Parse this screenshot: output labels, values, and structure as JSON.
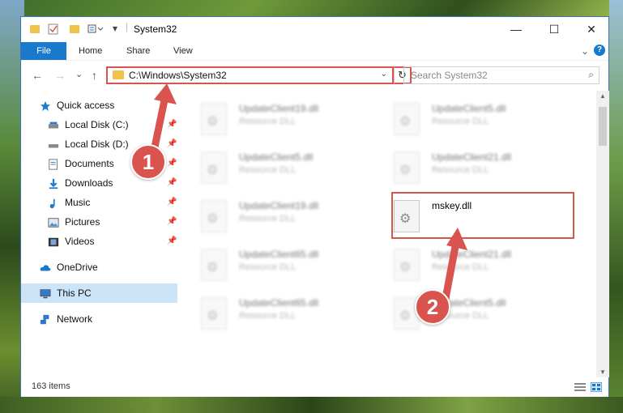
{
  "window": {
    "title": "System32",
    "min_glyph": "—",
    "max_glyph": "☐",
    "close_glyph": "✕"
  },
  "ribbon": {
    "tabs": [
      "File",
      "Home",
      "Share",
      "View"
    ],
    "help_glyph": "?",
    "expand_glyph": "⌄"
  },
  "navigation": {
    "back_glyph": "←",
    "forward_glyph": "→",
    "recent_glyph": "⌄",
    "up_glyph": "↑",
    "address_path": "C:\\Windows\\System32",
    "address_dropdown_glyph": "⌄",
    "refresh_glyph": "↻",
    "search_placeholder": "Search System32",
    "search_glyph": "⌕"
  },
  "nav_pane": {
    "items": [
      {
        "label": "Quick access",
        "icon": "star-icon",
        "pinned": false
      },
      {
        "label": "Local Disk (C:)",
        "icon": "drive-icon",
        "pinned": true
      },
      {
        "label": "Local Disk (D:)",
        "icon": "drive-icon",
        "pinned": true
      },
      {
        "label": "Documents",
        "icon": "documents-icon",
        "pinned": true
      },
      {
        "label": "Downloads",
        "icon": "download-icon",
        "pinned": true
      },
      {
        "label": "Music",
        "icon": "music-icon",
        "pinned": true
      },
      {
        "label": "Pictures",
        "icon": "pictures-icon",
        "pinned": true
      },
      {
        "label": "Videos",
        "icon": "videos-icon",
        "pinned": true
      },
      {
        "label": "OneDrive",
        "icon": "cloud-icon",
        "pinned": false
      },
      {
        "label": "This PC",
        "icon": "computer-icon",
        "pinned": false,
        "selected": true
      },
      {
        "label": "Network",
        "icon": "network-icon",
        "pinned": false
      }
    ],
    "pin_glyph": "📌"
  },
  "files": [
    {
      "name": "UpdateClient19.dll",
      "type": "Resource DLL",
      "blurred": true
    },
    {
      "name": "UpdateClient5.dll",
      "type": "Resource DLL",
      "blurred": true
    },
    {
      "name": "UpdateClient5.dll",
      "type": "Resource DLL",
      "blurred": true
    },
    {
      "name": "UpdateClient21.dll",
      "type": "Resource DLL",
      "blurred": true
    },
    {
      "name": "UpdateClient19.dll",
      "type": "Resource DLL",
      "blurred": true
    },
    {
      "name": "mskey.dll",
      "type": "",
      "blurred": false
    },
    {
      "name": "UpdateClient65.dll",
      "type": "Resource DLL",
      "blurred": true
    },
    {
      "name": "UpdateClient21.dll",
      "type": "Resource DLL",
      "blurred": true
    },
    {
      "name": "UpdateClient65.dll",
      "type": "Resource DLL",
      "blurred": true
    },
    {
      "name": "UpdateClient5.dll",
      "type": "Resource DLL",
      "blurred": true
    }
  ],
  "status": {
    "item_count": "163 items"
  },
  "annotations": {
    "step1": "1",
    "step2": "2",
    "highlight_color": "#d9534f"
  },
  "colors": {
    "accent": "#1979ca",
    "selected": "#cce4f7",
    "annotation_red": "#d9534f"
  }
}
